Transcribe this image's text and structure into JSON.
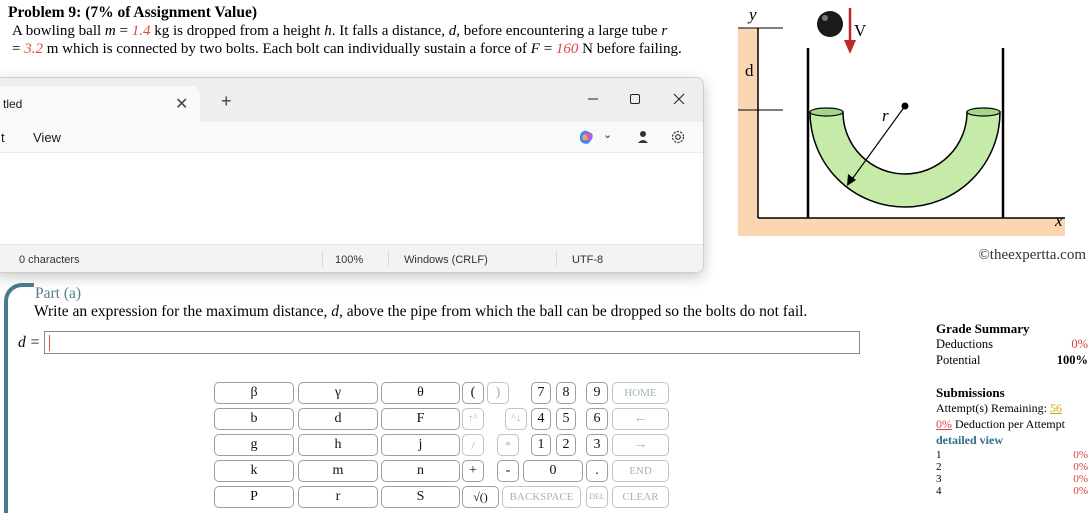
{
  "problem": {
    "title": "Problem 9: (7% of Assignment Value)",
    "text_1": "A bowling ball ",
    "m_sym": "m",
    "eq": " = ",
    "m_val": "1.4",
    "text_2": " kg is dropped from a height ",
    "h_sym": "h",
    "text_3": ". It falls a distance, ",
    "d_sym": "d",
    "text_4": ", before encountering a large tube ",
    "r_sym": "r",
    "eq2": "= ",
    "r_val": "3.2",
    "text_5": " m which is connected by two bolts. Each bolt can individually sustain a force of ",
    "F_sym": "F",
    "eq3": " = ",
    "F_val": "160",
    "text_6": " N before failing."
  },
  "figure": {
    "label_y": "y",
    "label_V": "V",
    "label_d": "d",
    "label_r": "r",
    "label_x": "x",
    "credit": "©theexpertta.com",
    "colors": {
      "tube_fill": "#c6eba9",
      "tube_inner": "#a3d88a",
      "floor": "#fbd6b3",
      "arrow": "#c0262d"
    }
  },
  "notepad": {
    "tab_title": "tled",
    "menu_edit": "t",
    "menu_view": "View",
    "status": {
      "chars": "0 characters",
      "zoom": "100%",
      "line_ending": "Windows (CRLF)",
      "encoding": "UTF-8"
    }
  },
  "part": {
    "title": "Part (a)",
    "question_1": "Write an expression for the maximum distance, ",
    "question_d": "d",
    "question_2": ", above the pipe from which the ball can be dropped so the bolts do not fail.",
    "answer_label": "d =",
    "answer_value": ""
  },
  "keypad": {
    "vars_row1": [
      "β",
      "γ",
      "θ"
    ],
    "vars_row2": [
      "b",
      "d",
      "F"
    ],
    "vars_row3": [
      "g",
      "h",
      "j"
    ],
    "vars_row4": [
      "k",
      "m",
      "n"
    ],
    "vars_row5": [
      "P",
      "r",
      "S"
    ],
    "ops": {
      "lparen": "(",
      "rparen": ")",
      "up": "↑^",
      "carat": "^↓",
      "div": "/",
      "mul": "*",
      "plus": "+",
      "minus": "-",
      "sqrt": "√()",
      "home": "HOME",
      "back": "←",
      "fwd": "→",
      "end": "END",
      "backspace": "BACKSPACE",
      "del": "DEL",
      "clear": "CLEAR",
      "dot": "."
    },
    "digits": [
      "7",
      "8",
      "9",
      "4",
      "5",
      "6",
      "1",
      "2",
      "3",
      "0"
    ]
  },
  "grade": {
    "heading": "Grade Summary",
    "deductions_label": "Deductions",
    "deductions_value": "0%",
    "potential_label": "Potential",
    "potential_value": "100%",
    "submissions_heading": "Submissions",
    "attempts_label": "Attempt(s) Remaining: ",
    "attempts_value": "56",
    "deduction_pct": "0%",
    "deduction_label": " Deduction per Attempt",
    "detailed_view": "detailed view",
    "rows": [
      {
        "n": "1",
        "v": "0%"
      },
      {
        "n": "2",
        "v": "0%"
      },
      {
        "n": "3",
        "v": "0%"
      },
      {
        "n": "4",
        "v": "0%"
      }
    ]
  }
}
